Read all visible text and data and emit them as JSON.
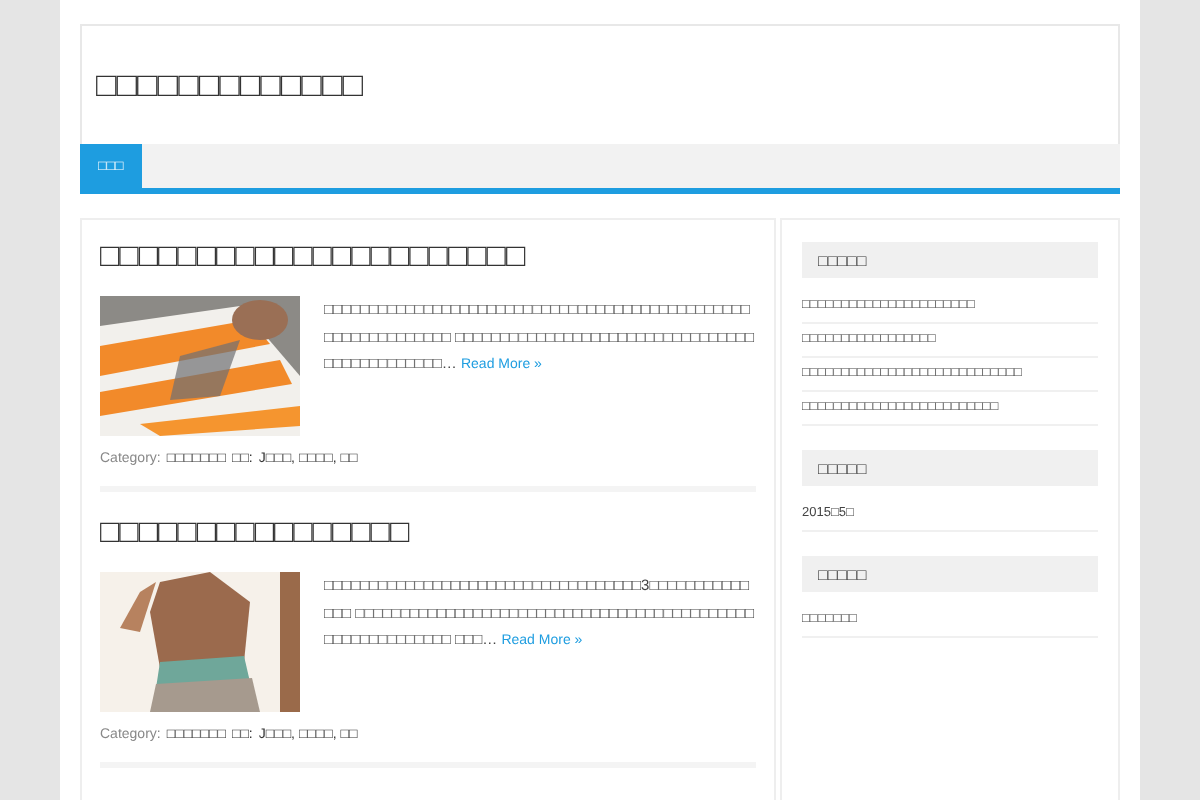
{
  "site": {
    "title": "□□□□□□□□□□□□□"
  },
  "nav": [
    {
      "label": "□□□",
      "selected": true
    }
  ],
  "posts": [
    {
      "title": "□□□□□□□□□□□□□□□□□□□□□□",
      "excerpt": "□□□□□□□□□□□□□□□□□□□□□□□□□□□□□□□□□□□□□□□□□□□□□□□□□□□□□□□□□□□□□ □□□□□□□□□□□□□□□□□□□□□□□□□□□□□□□□□□□□□□□□□□□□□□…",
      "read_more": "Read More »",
      "category_label": "Category:",
      "category": "□□□□□□□",
      "tags_label": "□□:",
      "tags": "J□□□, □□□□, □□"
    },
    {
      "title": "□□□□□□□□□□□□□□□□",
      "excerpt": "□□□□□□□□□□□□□□□□□□□□□□□□□□□□□□□□□□□3□□□□□□□□□□□□□□ □□□□□□□□□□□□□□□□□□□□□□□□□□□□□□□□□□□□□□□□□□□□□□□□□□□□□□□□□□ □□□…",
      "read_more": "Read More »",
      "category_label": "Category:",
      "category": "□□□□□□□",
      "tags_label": "□□:",
      "tags": "J□□□, □□□□, □□"
    }
  ],
  "sidebar": [
    {
      "title": "□□□□□",
      "items": [
        "□□□□□□□□□□□□□□□□□□□□□□",
        "□□□□□□□□□□□□□□□□□",
        "□□□□□□□□□□□□□□□□□□□□□□□□□□□□",
        "□□□□□□□□□□□□□□□□□□□□□□□□□"
      ]
    },
    {
      "title": "□□□□□",
      "items": [
        "2015□5□"
      ]
    },
    {
      "title": "□□□□□",
      "items": [
        "□□□□□□□"
      ]
    }
  ]
}
